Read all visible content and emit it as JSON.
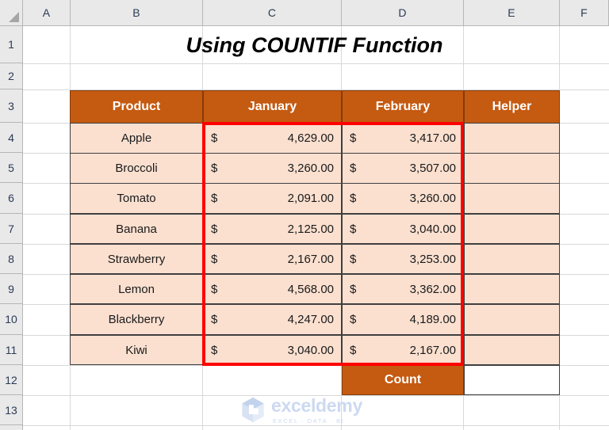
{
  "app": {
    "type": "spreadsheet",
    "title": "Using COUNTIF Function"
  },
  "grid": {
    "column_headers": [
      "A",
      "B",
      "C",
      "D",
      "E",
      "F"
    ],
    "row_headers": [
      "1",
      "2",
      "3",
      "4",
      "5",
      "6",
      "7",
      "8",
      "9",
      "10",
      "11",
      "12",
      "13"
    ]
  },
  "table": {
    "headers": [
      "Product",
      "January",
      "February",
      "Helper"
    ],
    "currency_symbol": "$",
    "rows": [
      {
        "product": "Apple",
        "january": "4,629.00",
        "february": "3,417.00",
        "helper": ""
      },
      {
        "product": "Broccoli",
        "january": "3,260.00",
        "february": "3,507.00",
        "helper": ""
      },
      {
        "product": "Tomato",
        "january": "2,091.00",
        "february": "3,260.00",
        "helper": ""
      },
      {
        "product": "Banana",
        "january": "2,125.00",
        "february": "3,040.00",
        "helper": ""
      },
      {
        "product": "Strawberry",
        "january": "2,167.00",
        "february": "3,253.00",
        "helper": ""
      },
      {
        "product": "Lemon",
        "january": "4,568.00",
        "february": "3,362.00",
        "helper": ""
      },
      {
        "product": "Blackberry",
        "january": "4,247.00",
        "february": "4,189.00",
        "helper": ""
      },
      {
        "product": "Kiwi",
        "january": "3,040.00",
        "february": "2,167.00",
        "helper": ""
      }
    ],
    "footer": {
      "count_label": "Count",
      "count_value": ""
    }
  },
  "selection": {
    "range": "C4:D11",
    "outline_color": "#ff0000"
  },
  "colors": {
    "header_fill": "#c55a11",
    "header_text": "#ffffff",
    "data_fill": "#fbe0d0",
    "cell_border": "#3f3f3f",
    "grid_line": "#d8d8d8",
    "row_header_fill": "#e9e9e9",
    "watermark": "#ccd9f0"
  },
  "watermark": {
    "name": "exceldemy",
    "tagline": "EXCEL · DATA · BI"
  }
}
